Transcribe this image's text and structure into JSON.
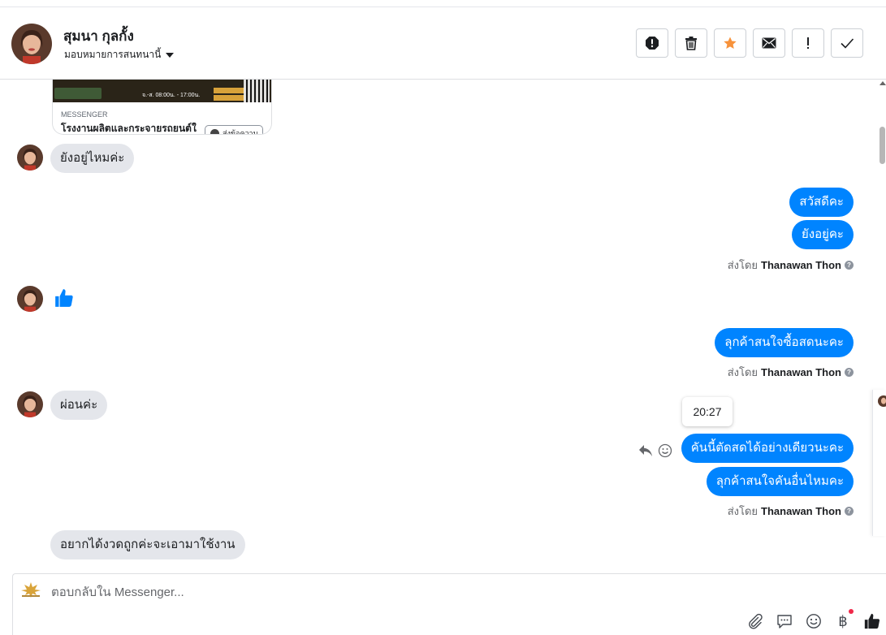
{
  "header": {
    "contact_name": "สุมนา กุลกั้ง",
    "assign_label": "มอบหมายการสนทนานี้",
    "tools": [
      {
        "name": "report-spam-icon"
      },
      {
        "name": "trash-icon"
      },
      {
        "name": "star-icon"
      },
      {
        "name": "mark-unread-icon"
      },
      {
        "name": "follow-up-icon"
      },
      {
        "name": "done-check-icon"
      }
    ]
  },
  "attachment": {
    "source": "MESSENGER",
    "title": "โรงงานผลิตและกระจายรถยนต์ใ",
    "banner_hours": "จ.-ส. 08:00น. - 17:00น.",
    "send_button": "ส่งข้อความ"
  },
  "messages": {
    "in_1": "ยังอยู่ไหมค่ะ",
    "out_1": "สวัสดีคะ",
    "out_2": "ยังอยู่คะ",
    "in_like": "like",
    "out_3": "ลุกค้าสนใจซื้อสดนะคะ",
    "in_2": "ผ่อนค่ะ",
    "out_4": "คันนี้ตัดสดได้อย่างเดียวนะคะ",
    "out_5": "ลุกค้าสนใจคันอื่นไหมคะ",
    "in_3": "อยากได้งวดถูกค่ะจะเอามาใช้งาน",
    "tooltip_time": "20:27"
  },
  "sent_by": {
    "prefix": "ส่งโดย",
    "agent": "Thanawan Thon",
    "help": "?"
  },
  "composer": {
    "placeholder": "ตอบกลับใน Messenger...",
    "baht_symbol": "฿"
  },
  "colors": {
    "accent": "#0084ff",
    "incoming_bubble": "#e4e6eb",
    "star": "#f7923b"
  }
}
